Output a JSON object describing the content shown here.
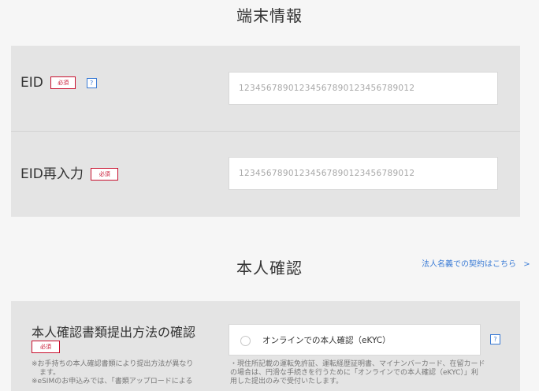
{
  "device_section": {
    "title": "端末情報",
    "eid": {
      "label": "EID",
      "required": "必須",
      "help": "?",
      "placeholder": "12345678901234567890123456789012"
    },
    "eid_confirm": {
      "label": "EID再入力",
      "required": "必須",
      "placeholder": "12345678901234567890123456789012"
    }
  },
  "identity_section": {
    "title": "本人確認",
    "corporate_link": "法人名義での契約はこちら",
    "corporate_link_arrow": ">",
    "method": {
      "label": "本人確認書類提出方法の確認",
      "required": "必須",
      "note_line1": "※お手持ちの本人確認書類により提出方法が異なり",
      "note_line2": "ます。",
      "note_line3": "※eSIMのお申込みでは、「書類アップロードによる",
      "option_label": "オンラインでの本人確認（eKYC）",
      "help": "?",
      "desc_line1": "・現住所記載の運転免許証、運転経歴証明書、マイナンバーカード、在留カード",
      "desc_line2": "の場合は、円滑な手続きを行うために「オンラインでの本人確認（eKYC）」利",
      "desc_line3": "用した提出のみで受付いたします。"
    }
  },
  "colors": {
    "background": "#f6f6f6",
    "panel": "#e4e4e4",
    "required": "#c8102e",
    "link": "#3a7bd5"
  }
}
